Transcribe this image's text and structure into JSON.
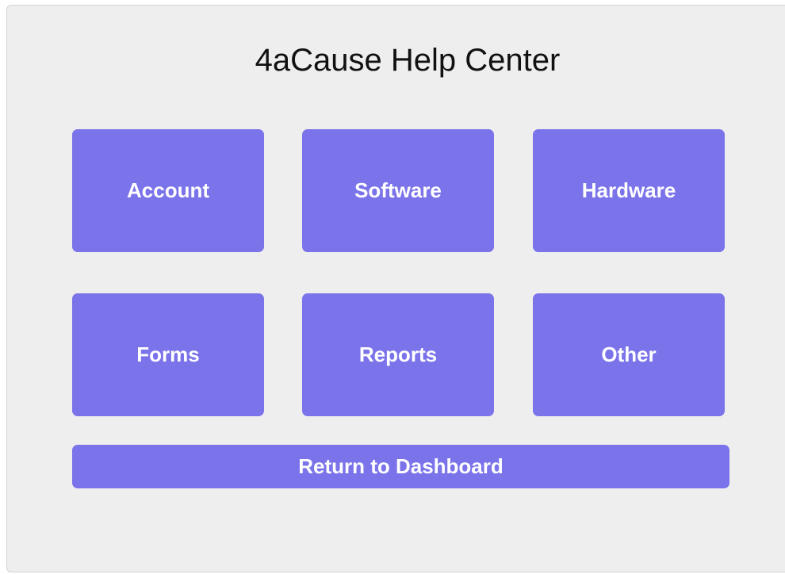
{
  "page": {
    "title": "4aCause Help Center"
  },
  "categories": [
    {
      "label": "Account"
    },
    {
      "label": "Software"
    },
    {
      "label": "Hardware"
    },
    {
      "label": "Forms"
    },
    {
      "label": "Reports"
    },
    {
      "label": "Other"
    }
  ],
  "actions": {
    "return_label": "Return to Dashboard"
  },
  "colors": {
    "accent": "#7b73ea",
    "panel_background": "#eeeeee",
    "text_on_accent": "#ffffff"
  }
}
